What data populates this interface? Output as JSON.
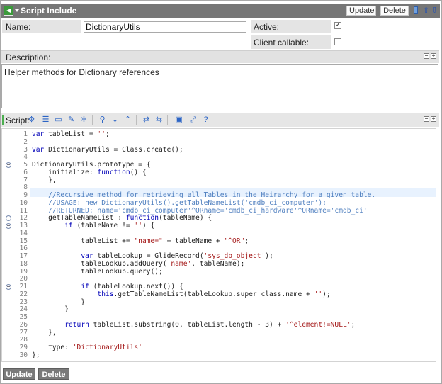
{
  "header": {
    "title": "Script Include",
    "update_label": "Update",
    "delete_label": "Delete"
  },
  "form": {
    "name_label": "Name:",
    "name_value": "DictionaryUtils",
    "active_label": "Active:",
    "active_checked": true,
    "client_callable_label": "Client callable:",
    "client_callable_checked": false,
    "description_label": "Description:",
    "description_value": "Helper methods for Dictionary references"
  },
  "script": {
    "label": "Script:",
    "lines": [
      {
        "n": "1",
        "text": "var tableList = '';"
      },
      {
        "n": "2",
        "text": ""
      },
      {
        "n": "3",
        "text": "var DictionaryUtils = Class.create();"
      },
      {
        "n": "4",
        "text": ""
      },
      {
        "n": "5",
        "text": "DictionaryUtils.prototype = {"
      },
      {
        "n": "6",
        "text": "    initialize: function() {"
      },
      {
        "n": "7",
        "text": "    },"
      },
      {
        "n": "8",
        "text": ""
      },
      {
        "n": "9",
        "text": "    //Recursive method for retrieving all Tables in the Heirarchy for a given table."
      },
      {
        "n": "10",
        "text": "    //USAGE: new DictionaryUtils().getTableNameList('cmdb_ci_computer');"
      },
      {
        "n": "11",
        "text": "    //RETURNED: name='cmdb_ci_computer'^ORname='cmdb_ci_hardware'^ORname='cmdb_ci'"
      },
      {
        "n": "12",
        "text": "    getTableNameList : function(tableName) {"
      },
      {
        "n": "13",
        "text": "        if (tableName != '') {"
      },
      {
        "n": "14",
        "text": ""
      },
      {
        "n": "15",
        "text": "            tableList += \"name=\" + tableName + \"^OR\";"
      },
      {
        "n": "16",
        "text": ""
      },
      {
        "n": "17",
        "text": "            var tableLookup = GlideRecord('sys_db_object');"
      },
      {
        "n": "18",
        "text": "            tableLookup.addQuery('name', tableName);"
      },
      {
        "n": "19",
        "text": "            tableLookup.query();"
      },
      {
        "n": "20",
        "text": ""
      },
      {
        "n": "21",
        "text": "            if (tableLookup.next()) {"
      },
      {
        "n": "22",
        "text": "                this.getTableNameList(tableLookup.super_class.name + '');"
      },
      {
        "n": "23",
        "text": "            }"
      },
      {
        "n": "24",
        "text": "        }"
      },
      {
        "n": "25",
        "text": ""
      },
      {
        "n": "26",
        "text": "        return tableList.substring(0, tableList.length - 3) + '^element!=NULL';"
      },
      {
        "n": "27",
        "text": "    },"
      },
      {
        "n": "28",
        "text": ""
      },
      {
        "n": "29",
        "text": "    type: 'DictionaryUtils'"
      },
      {
        "n": "30",
        "text": "};"
      }
    ]
  },
  "footer": {
    "update_label": "Update",
    "delete_label": "Delete"
  },
  "icons": {
    "back": "back-arrow-icon",
    "trash": "trash-icon",
    "up": "arrow-up-icon",
    "down": "arrow-down-icon"
  }
}
